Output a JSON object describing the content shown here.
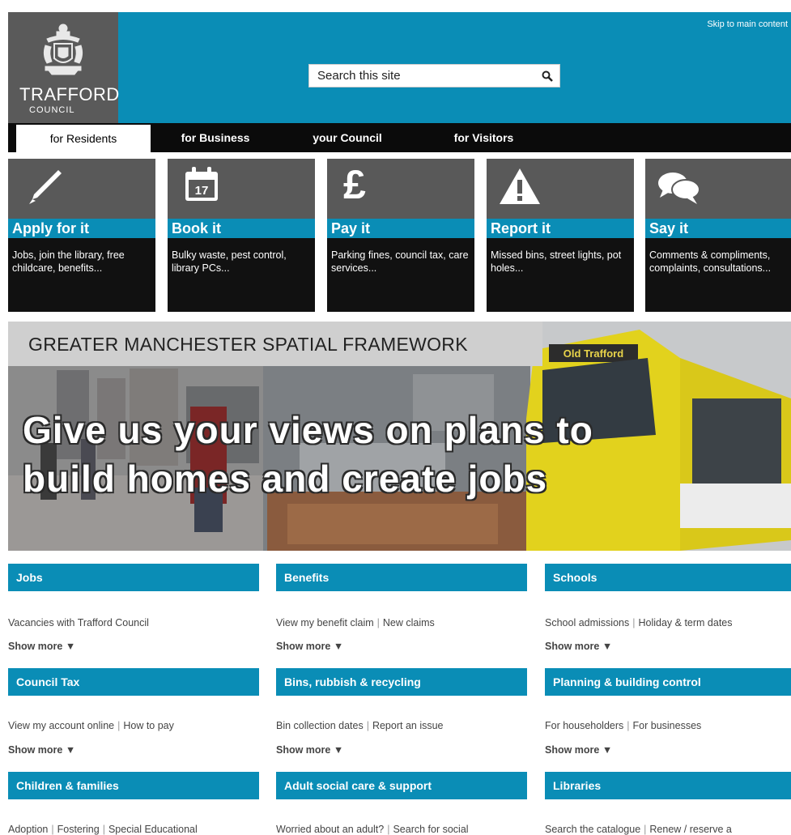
{
  "header": {
    "logo_name": "TRAFFORD",
    "logo_sub": "COUNCIL",
    "skip_link": "Skip to main content",
    "search_placeholder": "Search this site"
  },
  "nav": {
    "tabs": [
      "for Residents",
      "for Business",
      "your Council",
      "for Visitors"
    ],
    "active": "for Residents"
  },
  "tiles": [
    {
      "title": "Apply for it",
      "desc": "Jobs, join the library, free childcare, benefits...",
      "icon": "pen-icon"
    },
    {
      "title": "Book it",
      "desc": "Bulky waste, pest control, library PCs...",
      "icon": "calendar-icon",
      "calendar_day": "17"
    },
    {
      "title": "Pay it",
      "desc": "Parking fines, council tax, care services...",
      "icon": "pound-icon",
      "symbol": "£"
    },
    {
      "title": "Report it",
      "desc": "Missed bins, street lights, pot holes...",
      "icon": "warning-icon"
    },
    {
      "title": "Say it",
      "desc": "Comments & compliments, complaints, consultations...",
      "icon": "speech-bubbles-icon"
    }
  ],
  "banner": {
    "title": "GREATER MANCHESTER SPATIAL FRAMEWORK",
    "headline_line1": "Give us your views on plans to",
    "headline_line2": "build homes and create jobs",
    "tram_sign": "Old Trafford"
  },
  "categories": [
    {
      "title": "Jobs",
      "links": [
        "Vacancies with Trafford Council"
      ],
      "show_more": "Show more ▼"
    },
    {
      "title": "Benefits",
      "links": [
        "View my benefit claim",
        "New claims"
      ],
      "show_more": "Show more ▼"
    },
    {
      "title": "Schools",
      "links": [
        "School admissions",
        "Holiday & term dates"
      ],
      "show_more": "Show more ▼"
    },
    {
      "title": "Council Tax",
      "links": [
        "View my account online",
        "How to pay"
      ],
      "show_more": "Show more ▼"
    },
    {
      "title": "Bins, rubbish & recycling",
      "links": [
        "Bin collection dates",
        "Report an issue"
      ],
      "show_more": "Show more ▼"
    },
    {
      "title": "Planning & building control",
      "links": [
        "For householders",
        "For businesses"
      ],
      "show_more": "Show more ▼"
    },
    {
      "title": "Children & families",
      "links": [
        "Adoption",
        "Fostering",
        "Special Educational"
      ]
    },
    {
      "title": "Adult social care & support",
      "links": [
        "Worried about an adult?",
        "Search for social"
      ]
    },
    {
      "title": "Libraries",
      "links": [
        "Search the catalogue",
        "Renew / reserve a"
      ]
    }
  ],
  "colors": {
    "brand_blue": "#0a8db6",
    "dark": "#111111",
    "tile_grey": "#595959"
  }
}
